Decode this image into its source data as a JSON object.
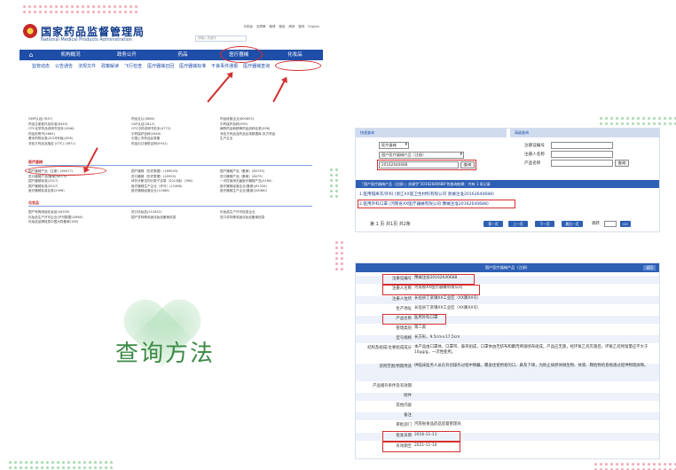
{
  "site": {
    "title": "国家药品监督管理局",
    "subtitle": "National Medical Products Administration",
    "top_links": [
      "手机版",
      "无障碍",
      "微博",
      "微信",
      "简体",
      "繁体",
      "English"
    ],
    "search_placeholder": "请输入关键字",
    "nav": [
      "机构概况",
      "政务公开",
      "药品",
      "医疗器械",
      "化妆品"
    ],
    "subnav": [
      "监管动态",
      "公告通告",
      "法规文件",
      "政策解读",
      "飞行检查",
      "医疗器械召回",
      "医疗器械标准",
      "不良事件通报",
      "医疗器械查询"
    ],
    "col1": [
      "GMP认证(7637)",
      "药品注册批件及标准(6440)",
      "OTC化学药品说明书范本(1846)",
      "药品说明书(2665)",
      "基本药物目录(2018年版)(395)",
      "非处方药品及指定 (OTC) (5871)"
    ],
    "col2": [
      "药品互认(3860)",
      "GSP认证(2812)",
      "OTC中药说明书范本(4772)",
      "中药保护品种(2849)",
      "中国上市药品目录集",
      "药品出口销售证明(5941)"
    ],
    "col3": [
      "药品经营企业(600853)",
      "中药保护品种(590)",
      "麻醉药品和精神药品品种目录(598)",
      "非处方药品及药品目录数据库-处方药品",
      "生产企业"
    ],
    "device_section": "医疗器械",
    "device_col1": [
      "国产器械产品（注册）(89477)",
      "进口器械产品(备案)(8079)",
      "国产器械标准(2327)",
      "国产器械标准(5247)",
      "医疗器械标准目录(2996)"
    ],
    "device_col2": [
      "国产器械（历史数据）(169043)",
      "进口器械（历史数据）(40929)",
      "体外诊断试剂分类子目录（2013版）(768)",
      "医疗器械生产企业（许可）(12486)",
      "医疗器械经营企业(12486)"
    ],
    "device_col3": [
      "国产器械产品（备案）(80755)",
      "进口器械产品（备案）(8079)",
      "一次性使用无菌医疗器械产品(3160)",
      "医疗器械经营企业(备案)(61334)",
      "医疗器械生产企业(备案)(28360)"
    ],
    "cosmetic_section": "化妆品",
    "cosmetic_col1": [
      "国产特殊用途化妆品(44559)",
      "化妆品生产许可企业(许可数据)(3860)",
      "化妆品品牌信息中国大陆备案(180)"
    ],
    "cosmetic_col2": [
      "进口化妆品(214452)",
      "国产非特殊用途化妆品备案信息"
    ],
    "cosmetic_col3": [
      "化妆品生产许可信息企业",
      "进口非特殊用途化妆品备案信息"
    ]
  },
  "query": {
    "quick_title": "快速查询",
    "advanced_title": "高级查询",
    "category_select": "医疗器械",
    "product_select": "国产医疗器械产品（注册）",
    "query_input": "20162640688",
    "query_button": "查询",
    "field_labels": [
      "注册证编号",
      "注册人名称",
      "产品名称"
    ],
    "advanced_button": "查询",
    "result_bar": "「国产医疗器械产品（注册）」关键字\"20162640688\"的查询结果：共有 1 条记录",
    "results": [
      "1.医用隔离衣/外科 (浙江XX医卫生材料有限公司 浙械注准20162640688)",
      "2.医用外科口罩 (河南省XX医疗器械有限公司 豫械注准20162640688)"
    ],
    "pager_text": "第 1 页 共1页 共2条",
    "pager_buttons": [
      "第一页",
      "上一页",
      "下一页",
      "最后一页"
    ],
    "jump_label": "跳转",
    "jump_button": "GO"
  },
  "detail": {
    "header": "国产医疗器械产品（注册）",
    "back": "返回",
    "rows": [
      {
        "label": "注册证编号",
        "value": "豫械注准20162640688"
      },
      {
        "label": "注册人名称",
        "value": "河南省XX医疗器械有限公司"
      },
      {
        "label": "注册人住所",
        "value": "长垣县丁栾镇XX工业区（XX路XX号）"
      },
      {
        "label": "生产地址",
        "value": "长垣县丁栾镇XX工业区（XX路XX号）"
      },
      {
        "label": "产品名称",
        "value": "医用外科口罩"
      },
      {
        "label": "管理类别",
        "value": "第二类"
      },
      {
        "label": "型号规格",
        "value": "长方形，9.5cm×17.5cm"
      },
      {
        "label": "结构及组成/主要组成成分",
        "value": "本产品由口罩体、口罩带、鼻夹组成，口罩体由无纺布和聚丙烯熔喷布组成。产品应无菌，经环氧乙烷灭菌后，环氧乙烷残留量应不大于10μg/g，一次性使用。"
      },
      {
        "label": "适用范围/预期用途",
        "value": "供临床医务人员在有创操作过程中佩戴，覆盖住使用者的口、鼻及下颌，为防止病原体微生物、体液、颗粒物的直接透过提供物理屏障。"
      },
      {
        "label": "产品储存条件及有效期",
        "value": ""
      },
      {
        "label": "附件",
        "value": ""
      },
      {
        "label": "其他内容",
        "value": ""
      },
      {
        "label": "备注",
        "value": ""
      },
      {
        "label": "审批部门",
        "value": "河南省食品药品监督管理局"
      },
      {
        "label": "批准日期",
        "value": "2016-11-11"
      },
      {
        "label": "有效期至",
        "value": "2021-11-10"
      }
    ]
  },
  "center_title": "查询方法",
  "colors": {
    "nav_blue": "#1f4ea8",
    "highlight_red": "#d32f2f",
    "title_green": "#3d8a46"
  }
}
